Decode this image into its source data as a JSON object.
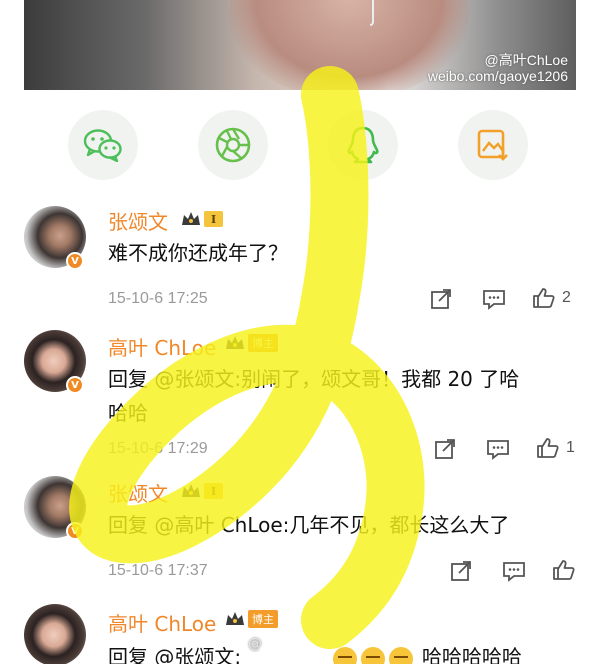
{
  "photo": {
    "watermark_handle": "@高叶ChLoe",
    "watermark_url": "weibo.com/gaoye1206"
  },
  "share": [
    {
      "icon": "wechat-icon"
    },
    {
      "icon": "moments-icon"
    },
    {
      "icon": "qq-icon"
    },
    {
      "icon": "save-image-icon"
    }
  ],
  "comments": [
    {
      "user": "张颂文",
      "level": "I",
      "text": "难不成你还成年了？",
      "time": "15-10-6 17:25",
      "likes": "2"
    },
    {
      "user": "高叶 ChLoe",
      "badge": "博主",
      "text_line1": "回复 @张颂文:别闹了，颂文哥！我都 20 了哈",
      "text_line2": "哈哈",
      "time": "15-10-6 17:29",
      "likes": "1"
    },
    {
      "user": "张颂文",
      "level": "I",
      "text": "回复 @高叶 ChLoe:几年不见，都长这么大了",
      "time": "15-10-6 17:37"
    },
    {
      "user": "高叶 ChLoe",
      "badge": "博主",
      "text_start": "回复 @张颂文:",
      "text_end": "哈哈哈哈哈"
    }
  ],
  "colors": {
    "name": "#f0882b",
    "highlight": "#f7f21a",
    "timestamp": "#9a9a9a"
  }
}
